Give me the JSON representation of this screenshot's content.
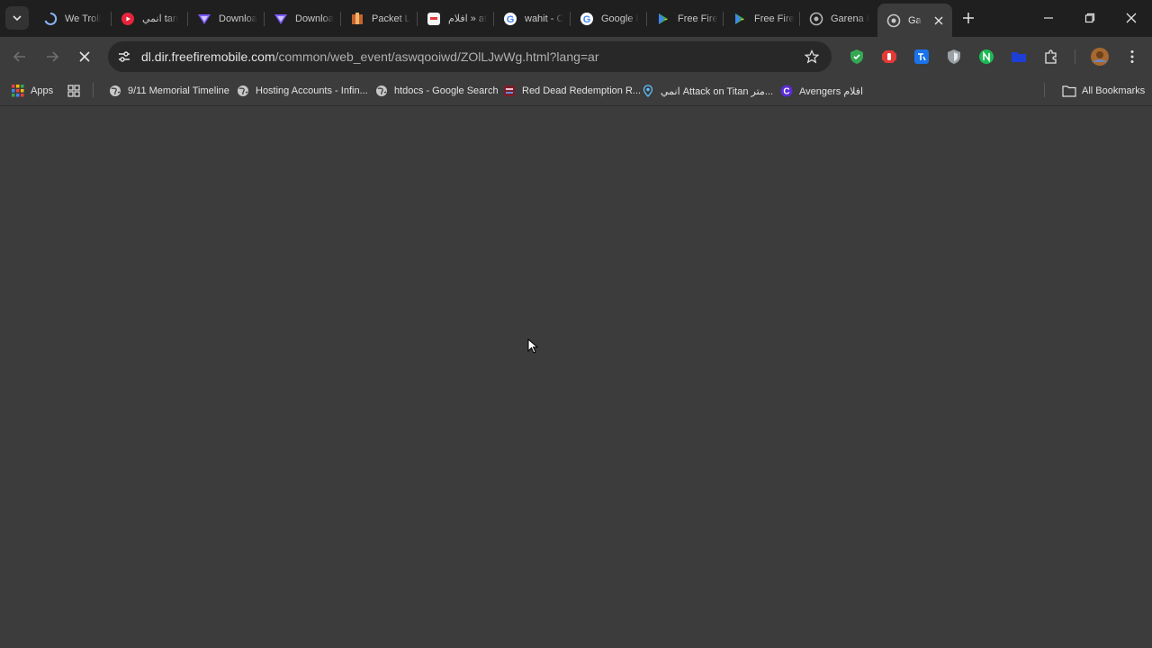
{
  "tabs": [
    {
      "title": "We Troll",
      "icon": "loading-spinner-icon"
    },
    {
      "title": "انمي tan",
      "icon": "youtube-icon"
    },
    {
      "title": "Downloa",
      "icon": "proton-vpn-icon"
    },
    {
      "title": "Downloa",
      "icon": "proton-vpn-icon"
    },
    {
      "title": "Packet L",
      "icon": "packet-icon"
    },
    {
      "title": "افلام » at",
      "icon": "site-icon"
    },
    {
      "title": "wahit - C",
      "icon": "google-icon"
    },
    {
      "title": "Google I",
      "icon": "google-icon"
    },
    {
      "title": "Free Fire",
      "icon": "google-play-icon"
    },
    {
      "title": "Free Fire",
      "icon": "google-play-icon"
    },
    {
      "title": "Garena I",
      "icon": "garena-icon"
    },
    {
      "title": "Gar",
      "icon": "garena-icon",
      "active": true
    }
  ],
  "address": {
    "domain": "dl.dir.freefiremobile.com",
    "path": "/common/web_event/aswqooiwd/ZOlLJwWg.html?lang=ar"
  },
  "bookmarks": {
    "apps": "Apps",
    "items": [
      {
        "label": "9/11 Memorial Timeline",
        "icon": "globe-icon"
      },
      {
        "label": "Hosting Accounts - Infin...",
        "icon": "globe-icon"
      },
      {
        "label": "htdocs - Google Search",
        "icon": "globe-icon"
      },
      {
        "label": "Red Dead Redemption R...",
        "icon": "rdr-icon"
      },
      {
        "label": "انمي Attack on Titan متر...",
        "icon": "location-pin-icon"
      },
      {
        "label": "Avengers افلام",
        "icon": "c-logo-icon"
      }
    ],
    "all": "All Bookmarks"
  },
  "colors": {
    "tabstrip": "#1f1f1f",
    "toolbar": "#3c3c3c",
    "omnibox": "#282828",
    "content": "#3c3c3c"
  }
}
